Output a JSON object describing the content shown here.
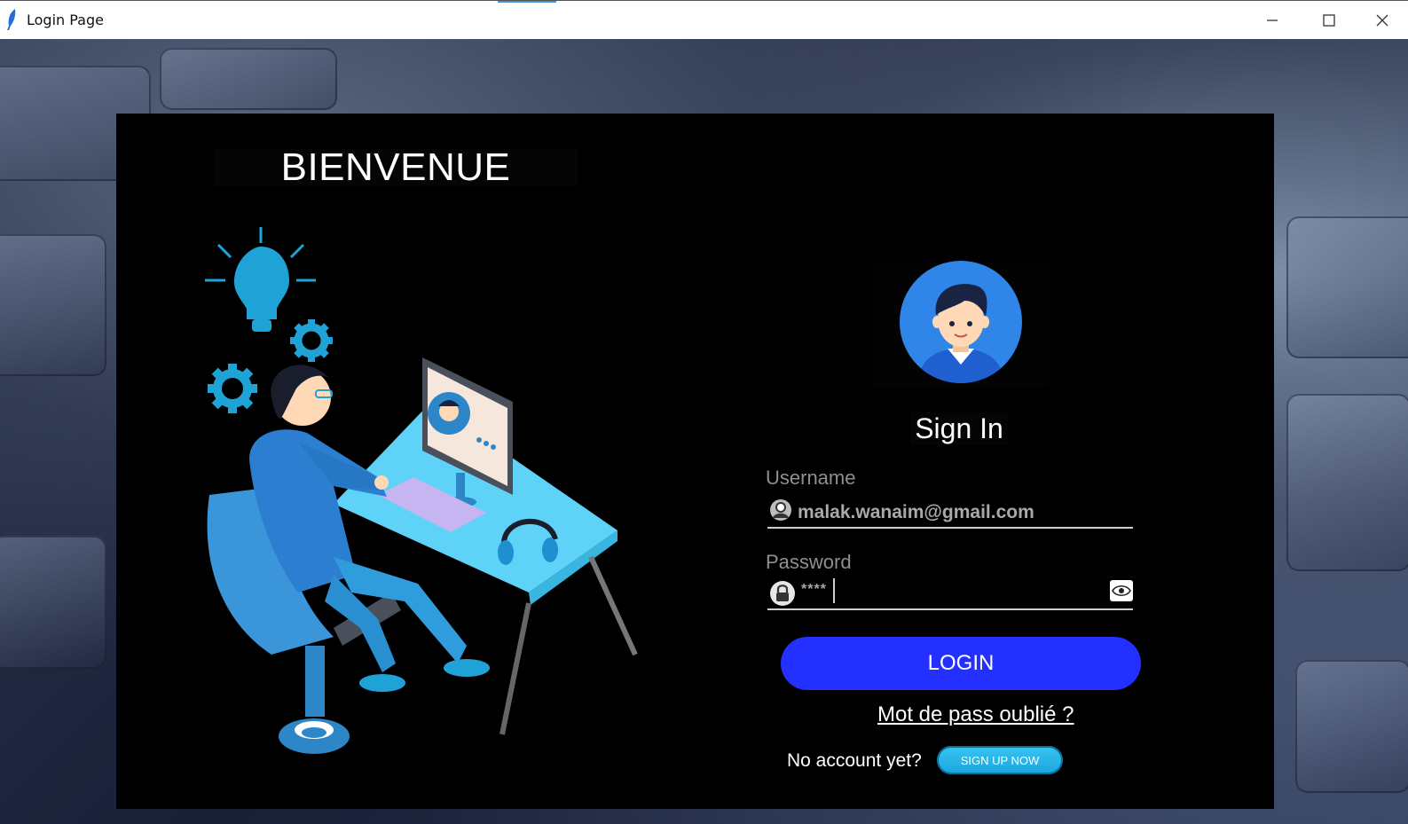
{
  "window": {
    "title": "Login Page",
    "minimize_icon": "minimize-icon",
    "maximize_icon": "maximize-icon",
    "close_icon": "close-icon"
  },
  "welcome": {
    "heading": "BIENVENUE"
  },
  "login_form": {
    "title": "Sign In",
    "username_label": "Username",
    "username_value": "malak.wanaim@gmail.com",
    "password_label": "Password",
    "password_value": "****",
    "login_button": "LOGIN",
    "forgot_password": "Mot de pass oublié ?",
    "no_account_text": "No account yet?",
    "signup_button": "SIGN UP NOW"
  },
  "colors": {
    "panel_bg": "#000000",
    "login_button": "#2430ff",
    "signup_button": "#1fb1e6",
    "illustration_accent": "#1fa3d6"
  }
}
